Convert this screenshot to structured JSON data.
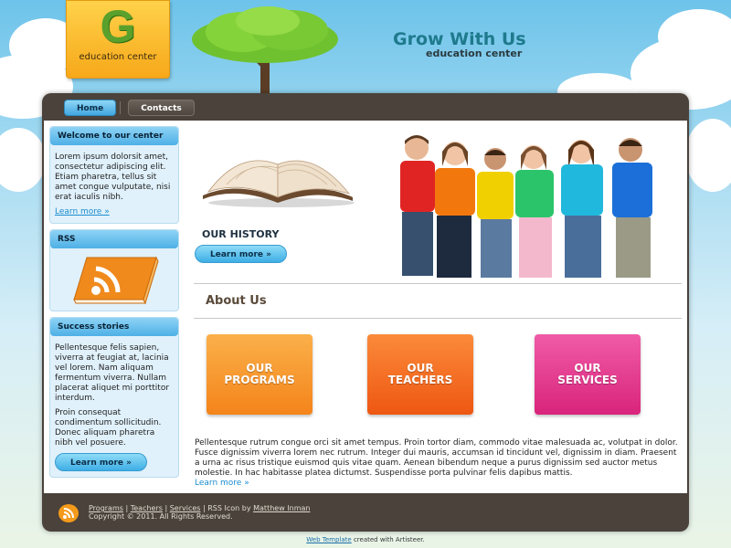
{
  "header": {
    "logo_letter": "G",
    "logo_text": "education center",
    "title": "Grow With Us",
    "slogan": "education center"
  },
  "nav": {
    "items": [
      {
        "label": "Home"
      },
      {
        "label": "Contacts"
      }
    ]
  },
  "sidebar": {
    "welcome": {
      "title": "Welcome to our center",
      "text": "Lorem ipsum dolorsit amet, consectetur adipiscing elit. Etiam pharetra, tellus sit amet congue vulputate, nisi erat iaculis nibh.",
      "link": "Learn more »"
    },
    "rss": {
      "title": "RSS"
    },
    "success": {
      "title": "Success stories",
      "text1": "Pellentesque felis sapien, viverra at feugiat at, lacinia vel lorem. Nam aliquam fermentum viverra. Nullam placerat aliquet mi porttitor interdum.",
      "text2": "Proin consequat condimentum sollicitudin. Donec aliquam pharetra nibh vel posuere.",
      "button": "Learn more »"
    }
  },
  "main": {
    "history_title": "OUR HISTORY",
    "history_button": "Learn more »",
    "about_title": "About Us",
    "tiles": [
      {
        "line1": "OUR",
        "line2": "PROGRAMS"
      },
      {
        "line1": "OUR",
        "line2": "TEACHERS"
      },
      {
        "line1": "OUR",
        "line2": "SERVICES"
      }
    ],
    "about_text": "Pellentesque rutrum congue orci sit amet tempus. Proin tortor diam, commodo vitae malesuada ac, volutpat in dolor. Fusce dignissim viverra lorem nec rutrum. Integer dui mauris, accumsan id tincidunt vel, dignissim in diam. Praesent a urna ac risus tristique euismod quis vitae quam. Aenean bibendum neque a purus dignissim sed auctor metus molestie. In hac habitasse platea dictumst. Suspendisse porta pulvinar felis dapibus mattis.",
    "about_link": "Learn more »"
  },
  "footer": {
    "links": [
      "Programs",
      "Teachers",
      "Services"
    ],
    "sep": "|",
    "rss_credit_prefix": "| RSS Icon by",
    "rss_credit_author": "Matthew Inman",
    "copyright": "Copyright © 2011. All Rights Reserved."
  },
  "credit": {
    "link": "Web Template",
    "suffix": "created with Artisteer."
  },
  "colors": {
    "accent": "#1e7a8c",
    "nav_active": "#42a7e0",
    "sheet": "#4a423b"
  }
}
